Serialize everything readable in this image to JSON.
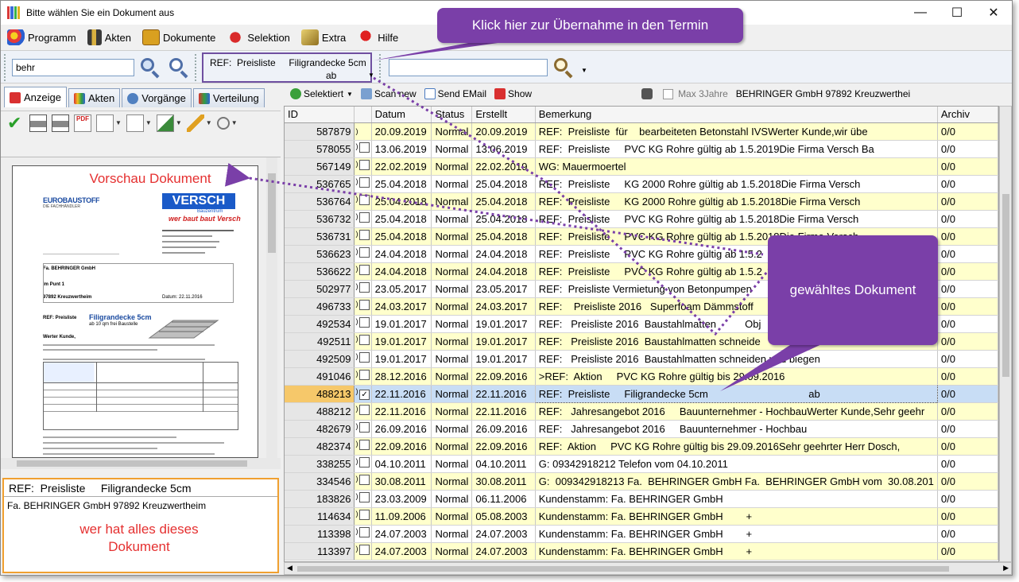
{
  "window": {
    "title": "Bitte wählen Sie ein Dokument aus"
  },
  "menu": [
    "Programm",
    "Akten",
    "Dokumente",
    "Selektion",
    "Extra",
    "Hilfe"
  ],
  "search": {
    "value": "behr"
  },
  "ref_box": {
    "line1": "REF:  Preisliste     Filigrandecke 5cm",
    "line2": "ab"
  },
  "tabs": [
    "Anzeige",
    "Akten",
    "Vorgänge",
    "Verteilung"
  ],
  "right_toolbar": {
    "selektiert": "Selektiert",
    "scan_new": "Scan new",
    "send_email": "Send EMail",
    "show": "Show",
    "max_3jahre": "Max 3Jahre",
    "client": "BEHRINGER GmbH 97892 Kreuzwerthei"
  },
  "grid": {
    "columns": [
      "ID",
      "",
      "Datum",
      "Status",
      "Erstellt",
      "Bemerkung",
      "Archiv"
    ],
    "rows": [
      {
        "id": "587879",
        "datum": "20.09.2019",
        "status": "Normal",
        "erstellt": "20.09.2019",
        "bemerkung": "REF:  Preisliste  für    bearbeiteten Betonstahl IVSWerter Kunde,wir übe",
        "archiv": "0/0",
        "color": "yellow",
        "checked": false,
        "has_box": false
      },
      {
        "id": "578055",
        "datum": "13.06.2019",
        "status": "Normal",
        "erstellt": "13.06.2019",
        "bemerkung": "REF:  Preisliste     PVC KG Rohre gültig ab 1.5.2019Die Firma Versch Ba",
        "archiv": "0/0",
        "color": "white",
        "checked": false,
        "has_box": true
      },
      {
        "id": "567149",
        "datum": "22.02.2019",
        "status": "Normal",
        "erstellt": "22.02.2019",
        "bemerkung": "WG: Mauermoertel",
        "archiv": "0/0",
        "color": "yellow",
        "checked": false,
        "has_box": true
      },
      {
        "id": "536765",
        "datum": "25.04.2018",
        "status": "Normal",
        "erstellt": "25.04.2018",
        "bemerkung": "REF:  Preisliste     KG 2000 Rohre gültig ab 1.5.2018Die Firma Versch",
        "archiv": "0/0",
        "color": "white",
        "checked": false,
        "has_box": true
      },
      {
        "id": "536764",
        "datum": "25.04.2018",
        "status": "Normal",
        "erstellt": "25.04.2018",
        "bemerkung": "REF:  Preisliste     KG 2000 Rohre gültig ab 1.5.2018Die Firma Versch",
        "archiv": "0/0",
        "color": "yellow",
        "checked": false,
        "has_box": true
      },
      {
        "id": "536732",
        "datum": "25.04.2018",
        "status": "Normal",
        "erstellt": "25.04.2018",
        "bemerkung": "REF:  Preisliste     PVC KG Rohre gültig ab 1.5.2018Die Firma Versch",
        "archiv": "0/0",
        "color": "white",
        "checked": false,
        "has_box": true
      },
      {
        "id": "536731",
        "datum": "25.04.2018",
        "status": "Normal",
        "erstellt": "25.04.2018",
        "bemerkung": "REF:  Preisliste     PVC KG Rohre gültig ab 1.5.2018Die Firma Versch",
        "archiv": "0/0",
        "color": "yellow",
        "checked": false,
        "has_box": true
      },
      {
        "id": "536623",
        "datum": "24.04.2018",
        "status": "Normal",
        "erstellt": "24.04.2018",
        "bemerkung": "REF:  Preisliste     PVC KG Rohre gültig ab 1.5.2",
        "archiv": "0/0",
        "color": "white",
        "checked": false,
        "has_box": true
      },
      {
        "id": "536622",
        "datum": "24.04.2018",
        "status": "Normal",
        "erstellt": "24.04.2018",
        "bemerkung": "REF:  Preisliste     PVC KG Rohre gültig ab 1.5.2",
        "archiv": "0/0",
        "color": "yellow",
        "checked": false,
        "has_box": true
      },
      {
        "id": "502977",
        "datum": "23.05.2017",
        "status": "Normal",
        "erstellt": "23.05.2017",
        "bemerkung": "REF:  Preisliste Vermietung von Betonpumpen",
        "archiv": "0/0",
        "color": "white",
        "checked": false,
        "has_box": true
      },
      {
        "id": "496733",
        "datum": "24.03.2017",
        "status": "Normal",
        "erstellt": "24.03.2017",
        "bemerkung": "REF:    Preisliste 2016   Superfoam Dämmstoff",
        "archiv": "0/0",
        "color": "yellow",
        "checked": false,
        "has_box": true
      },
      {
        "id": "492534",
        "datum": "19.01.2017",
        "status": "Normal",
        "erstellt": "19.01.2017",
        "bemerkung": "REF:   Preisliste 2016  Baustahlmatten          Obj",
        "archiv": "0/0",
        "color": "white",
        "checked": false,
        "has_box": true
      },
      {
        "id": "492511",
        "datum": "19.01.2017",
        "status": "Normal",
        "erstellt": "19.01.2017",
        "bemerkung": "REF:   Preisliste 2016  Baustahlmatten schneide",
        "archiv": "0/0",
        "color": "yellow",
        "checked": false,
        "has_box": true
      },
      {
        "id": "492509",
        "datum": "19.01.2017",
        "status": "Normal",
        "erstellt": "19.01.2017",
        "bemerkung": "REF:   Preisliste 2016  Baustahlmatten schneiden und biegen",
        "archiv": "0/0",
        "color": "white",
        "checked": false,
        "has_box": true
      },
      {
        "id": "491046",
        "datum": "28.12.2016",
        "status": "Normal",
        "erstellt": "22.09.2016",
        "bemerkung": ">REF:  Aktion     PVC KG Rohre gültig bis 29.09.2016",
        "archiv": "0/0",
        "color": "yellow",
        "checked": false,
        "has_box": true
      },
      {
        "id": "488213",
        "datum": "22.11.2016",
        "status": "Normal",
        "erstellt": "22.11.2016",
        "bemerkung": "REF:  Preisliste     Filigrandecke 5cm                                   ab",
        "archiv": "0/0",
        "color": "selected",
        "checked": true,
        "has_box": true
      },
      {
        "id": "488212",
        "datum": "22.11.2016",
        "status": "Normal",
        "erstellt": "22.11.2016",
        "bemerkung": "REF:   Jahresangebot 2016     Bauunternehmer - HochbauWerter Kunde,Sehr geehr",
        "archiv": "0/0",
        "color": "yellow",
        "checked": false,
        "has_box": true
      },
      {
        "id": "482679",
        "datum": "26.09.2016",
        "status": "Normal",
        "erstellt": "26.09.2016",
        "bemerkung": "REF:   Jahresangebot 2016     Bauunternehmer - Hochbau",
        "archiv": "0/0",
        "color": "white",
        "checked": false,
        "has_box": true
      },
      {
        "id": "482374",
        "datum": "22.09.2016",
        "status": "Normal",
        "erstellt": "22.09.2016",
        "bemerkung": "REF:  Aktion     PVC KG Rohre gültig bis 29.09.2016Sehr geehrter Herr Dosch,",
        "archiv": "0/0",
        "color": "yellow",
        "checked": false,
        "has_box": true
      },
      {
        "id": "338255",
        "datum": "04.10.2011",
        "status": "Normal",
        "erstellt": "04.10.2011",
        "bemerkung": "G: 09342918212 Telefon vom 04.10.2011",
        "archiv": "0/0",
        "color": "white",
        "checked": false,
        "has_box": true
      },
      {
        "id": "334546",
        "datum": "30.08.2011",
        "status": "Normal",
        "erstellt": "30.08.2011",
        "bemerkung": "G:  009342918213 Fa.  BEHRINGER GmbH Fa.  BEHRINGER GmbH vom  30.08.201",
        "archiv": "0/0",
        "color": "yellow",
        "checked": false,
        "has_box": true
      },
      {
        "id": "183826",
        "datum": "23.03.2009",
        "status": "Normal",
        "erstellt": "06.11.2006",
        "bemerkung": "Kundenstamm: Fa. BEHRINGER GmbH",
        "archiv": "0/0",
        "color": "white",
        "checked": false,
        "has_box": true
      },
      {
        "id": "114634",
        "datum": "11.09.2006",
        "status": "Normal",
        "erstellt": "05.08.2003",
        "bemerkung": "Kundenstamm: Fa. BEHRINGER GmbH        +",
        "archiv": "0/0",
        "color": "yellow",
        "checked": false,
        "has_box": true
      },
      {
        "id": "113398",
        "datum": "24.07.2003",
        "status": "Normal",
        "erstellt": "24.07.2003",
        "bemerkung": "Kundenstamm: Fa. BEHRINGER GmbH        +",
        "archiv": "0/0",
        "color": "white",
        "checked": false,
        "has_box": true
      },
      {
        "id": "113397",
        "datum": "24.07.2003",
        "status": "Normal",
        "erstellt": "24.07.2003",
        "bemerkung": "Kundenstamm: Fa. BEHRINGER GmbH        +",
        "archiv": "0/0",
        "color": "yellow",
        "checked": false,
        "has_box": true
      }
    ]
  },
  "preview": {
    "logo_left_top": "EUROBAUSTOFF",
    "logo_left_bottom": "DIE FACHHÄNDLER",
    "logo_right": "VERSCH",
    "logo_right_sub": "Bauzentrum",
    "slogan": "wer baut baut Versch",
    "recipient": "Fa. BEHRINGER GmbH",
    "recipient_line2": "Im Punt 1",
    "recipient_city": "97892 Kreuzwertheim",
    "ref_label": "REF:  Preisliste",
    "ref_title": "Filigrandecke 5cm",
    "ref_sub": "ab 10 qm frei Baustelle",
    "greeting": "Werter Kunde,",
    "date": "Datum: 22.11.2016"
  },
  "info_box": {
    "header": "REF:  Preisliste     Filigrandecke 5cm",
    "line": "Fa. BEHRINGER GmbH 97892 Kreuzwertheim"
  },
  "annotations": {
    "callout_top": "Klick hier zur Übernahme in den Termin",
    "callout_selected": "gewähltes Dokument",
    "vorschau": "Vorschau Dokument",
    "wer_hat": "wer hat alles dieses\nDokument"
  },
  "colors": {
    "callout": "#7a3fa8",
    "row_yellow": "#ffffcc",
    "row_selected": "#c8ddf5",
    "annotation_red": "#e53030",
    "info_border": "#f0a030"
  }
}
